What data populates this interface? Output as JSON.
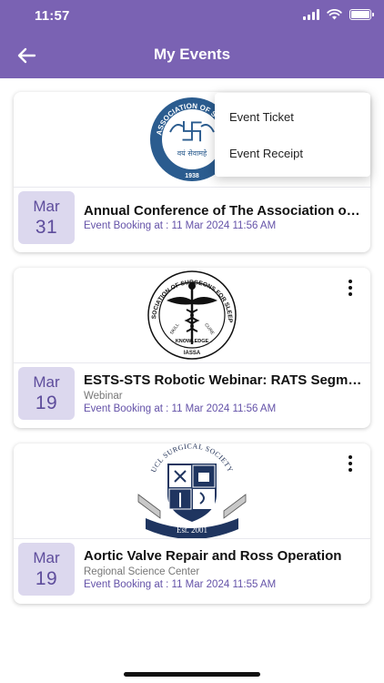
{
  "status_bar": {
    "time": "11:57"
  },
  "header": {
    "title": "My Events"
  },
  "popup_menu": {
    "items": [
      "Event Ticket",
      "Event Receipt"
    ]
  },
  "events": [
    {
      "month": "Mar",
      "day": "31",
      "title": "Annual Conference of The Association of Surgeons of India",
      "subtitle": "",
      "booking": "Event Booking at : 11 Mar 2024 11:56 AM",
      "logo": {
        "name": "asi-logo",
        "text_top": "THE ASSOCIATION OF SURGEONS",
        "motto": "वयं सेवामहे",
        "year": "1938"
      }
    },
    {
      "month": "Mar",
      "day": "19",
      "title": "ESTS-STS Robotic Webinar: RATS Segmentectomy",
      "subtitle": "Webinar",
      "booking": "Event Booking at : 11 Mar 2024 11:56 AM",
      "logo": {
        "name": "iassa-logo",
        "text_ring": "INDIAN ASSOCIATION OF SURGEONS FOR SLEEP APNOEA",
        "left": "SKILL",
        "right": "CURE",
        "bottom": "KNOWLEDGE",
        "abbr": "IASSA"
      }
    },
    {
      "month": "Mar",
      "day": "19",
      "title": "Aortic Valve Repair and Ross Operation",
      "subtitle": "Regional Science Center",
      "booking": "Event Booking at : 11 Mar 2024 11:55 AM",
      "logo": {
        "name": "ucl-surgical-society-logo",
        "arc_text": "UCL SURGICAL SOCIETY",
        "est": "Est. 2001"
      }
    }
  ],
  "colors": {
    "header": "#7a62b3",
    "date_bg": "#dcd8ee",
    "date_text": "#5e4d9c",
    "booking_text": "#6452a8"
  },
  "icons": [
    "back-arrow-icon",
    "wifi-icon",
    "signal-icon",
    "battery-icon",
    "more-vertical-icon"
  ]
}
